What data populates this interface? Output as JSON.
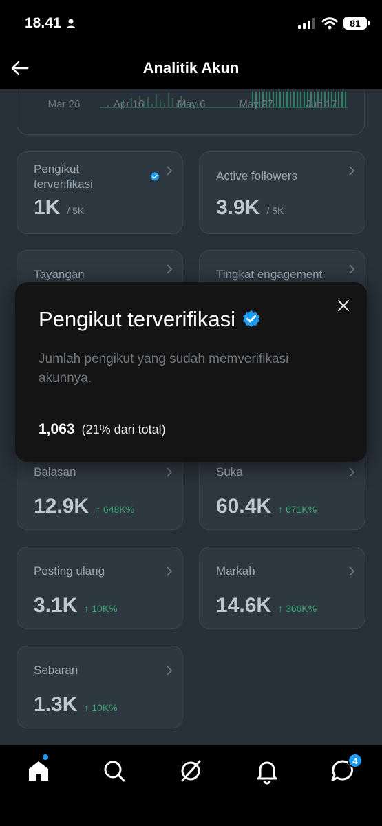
{
  "status_bar": {
    "time": "18.41",
    "battery": "81"
  },
  "header": {
    "title": "Analitik Akun"
  },
  "chart": {
    "dates": [
      "Mar 26",
      "Apr 16",
      "May 6",
      "May 27",
      "Jun 17"
    ]
  },
  "stats": [
    {
      "title": "Pengikut terverifikasi",
      "value": "1K",
      "sub": "/ 5K",
      "change": ""
    },
    {
      "title": "Active followers",
      "value": "3.9K",
      "sub": "/ 5K",
      "change": ""
    },
    {
      "title": "Tayangan",
      "value": "",
      "sub": "",
      "change": ""
    },
    {
      "title": "Tingkat engagement",
      "value": "",
      "sub": "",
      "change": ""
    },
    {
      "title": "Balasan",
      "value": "12.9K",
      "sub": "",
      "change": "↑ 648K%"
    },
    {
      "title": "Suka",
      "value": "60.4K",
      "sub": "",
      "change": "↑ 671K%"
    },
    {
      "title": "Posting ulang",
      "value": "3.1K",
      "sub": "",
      "change": "↑ 10K%"
    },
    {
      "title": "Markah",
      "value": "14.6K",
      "sub": "",
      "change": "↑ 366K%"
    },
    {
      "title": "Sebaran",
      "value": "1.3K",
      "sub": "",
      "change": "↑ 10K%"
    }
  ],
  "popup": {
    "title": "Pengikut terverifikasi",
    "description": "Jumlah pengikut yang sudah memverifikasi akunnya.",
    "count": "1,063",
    "count_note": "(21% dari total)"
  },
  "tab_bar": {
    "messages_badge": "4"
  },
  "colors": {
    "accent": "#1d9bf0",
    "positive": "#3aa673",
    "background": "#283139"
  }
}
